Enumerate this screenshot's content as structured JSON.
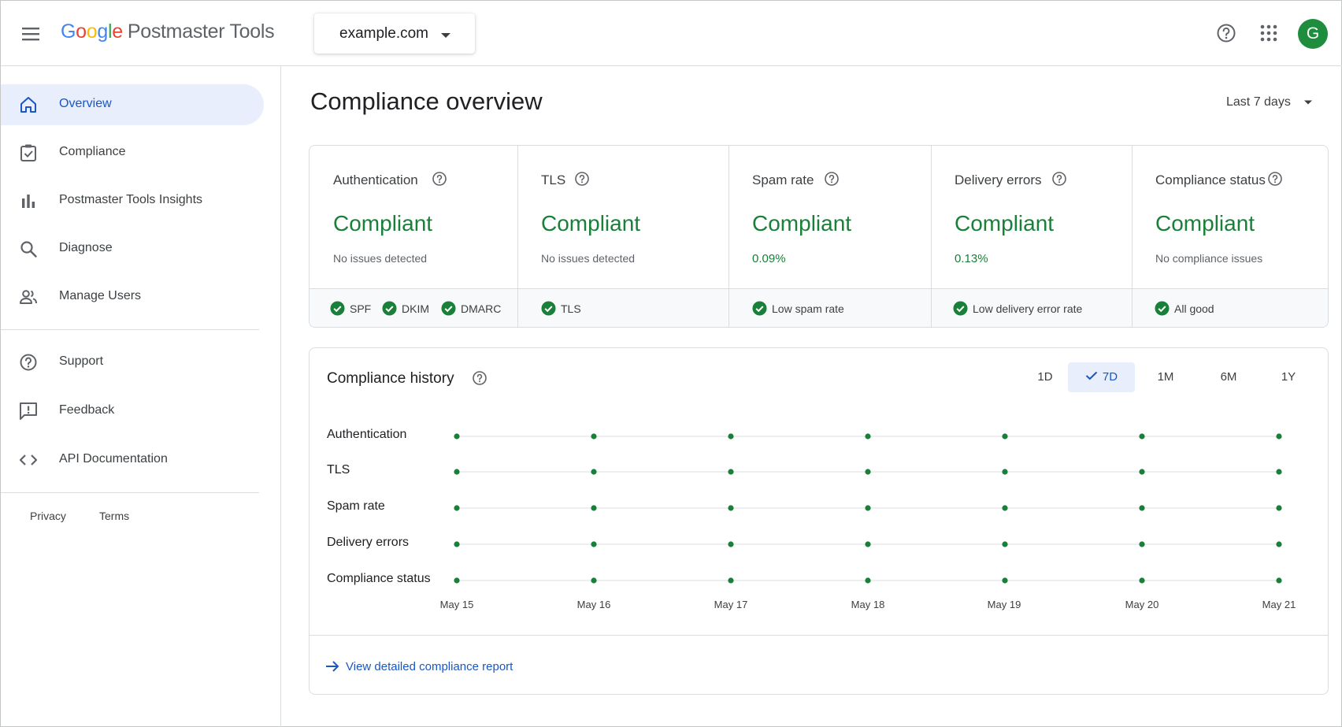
{
  "header": {
    "logo_parts": [
      "G",
      "o",
      "o",
      "g",
      "l",
      "e"
    ],
    "product_name": "Postmaster Tools",
    "domain": "example.com",
    "avatar_letter": "G"
  },
  "sidebar": {
    "items": [
      {
        "label": "Overview",
        "icon": "home-icon",
        "active": true
      },
      {
        "label": "Compliance",
        "icon": "checkbox-icon"
      },
      {
        "label": "Postmaster Tools Insights",
        "icon": "bar-chart-icon"
      },
      {
        "label": "Diagnose",
        "icon": "search-icon"
      },
      {
        "label": "Manage Users",
        "icon": "users-icon"
      }
    ],
    "secondary": [
      {
        "label": "Support",
        "icon": "help-icon"
      },
      {
        "label": "Feedback",
        "icon": "feedback-icon"
      },
      {
        "label": "API Documentation",
        "icon": "code-icon"
      }
    ],
    "footer": {
      "privacy": "Privacy",
      "terms": "Terms"
    }
  },
  "main": {
    "title": "Compliance overview",
    "range": "Last 7 days",
    "metrics": [
      {
        "title": "Authentication",
        "status": "Compliant",
        "sub": "No issues detected",
        "checks": [
          "SPF",
          "DKIM",
          "DMARC"
        ]
      },
      {
        "title": "TLS",
        "status": "Compliant",
        "sub": "No issues detected",
        "checks": [
          "TLS"
        ]
      },
      {
        "title": "Spam rate",
        "status": "Compliant",
        "sub": "0.09%",
        "checks": [
          "Low spam rate"
        ]
      },
      {
        "title": "Delivery errors",
        "status": "Compliant",
        "sub": "0.13%",
        "checks": [
          "Low delivery error rate"
        ]
      },
      {
        "title": "Compliance status",
        "status": "Compliant",
        "sub": "No compliance issues",
        "checks": [
          "All good"
        ]
      }
    ],
    "history": {
      "title": "Compliance history",
      "periods": [
        "1D",
        "7D",
        "1M",
        "6M",
        "1Y"
      ],
      "active_period": "7D",
      "link": "View detailed compliance report"
    }
  },
  "chart_data": {
    "type": "scatter",
    "x": [
      "May 15",
      "May 16",
      "May 17",
      "May 18",
      "May 19",
      "May 20",
      "May 21"
    ],
    "series": [
      {
        "name": "Authentication",
        "values": [
          "compliant",
          "compliant",
          "compliant",
          "compliant",
          "compliant",
          "compliant",
          "compliant"
        ]
      },
      {
        "name": "TLS",
        "values": [
          "compliant",
          "compliant",
          "compliant",
          "compliant",
          "compliant",
          "compliant",
          "compliant"
        ]
      },
      {
        "name": "Spam rate",
        "values": [
          "compliant",
          "compliant",
          "compliant",
          "compliant",
          "compliant",
          "compliant",
          "compliant"
        ]
      },
      {
        "name": "Delivery errors",
        "values": [
          "compliant",
          "compliant",
          "compliant",
          "compliant",
          "compliant",
          "compliant",
          "compliant"
        ]
      },
      {
        "name": "Compliance status",
        "values": [
          "compliant",
          "compliant",
          "compliant",
          "compliant",
          "compliant",
          "compliant",
          "compliant"
        ]
      }
    ],
    "colors": {
      "compliant": "#188038",
      "line": "#dadce0"
    }
  }
}
